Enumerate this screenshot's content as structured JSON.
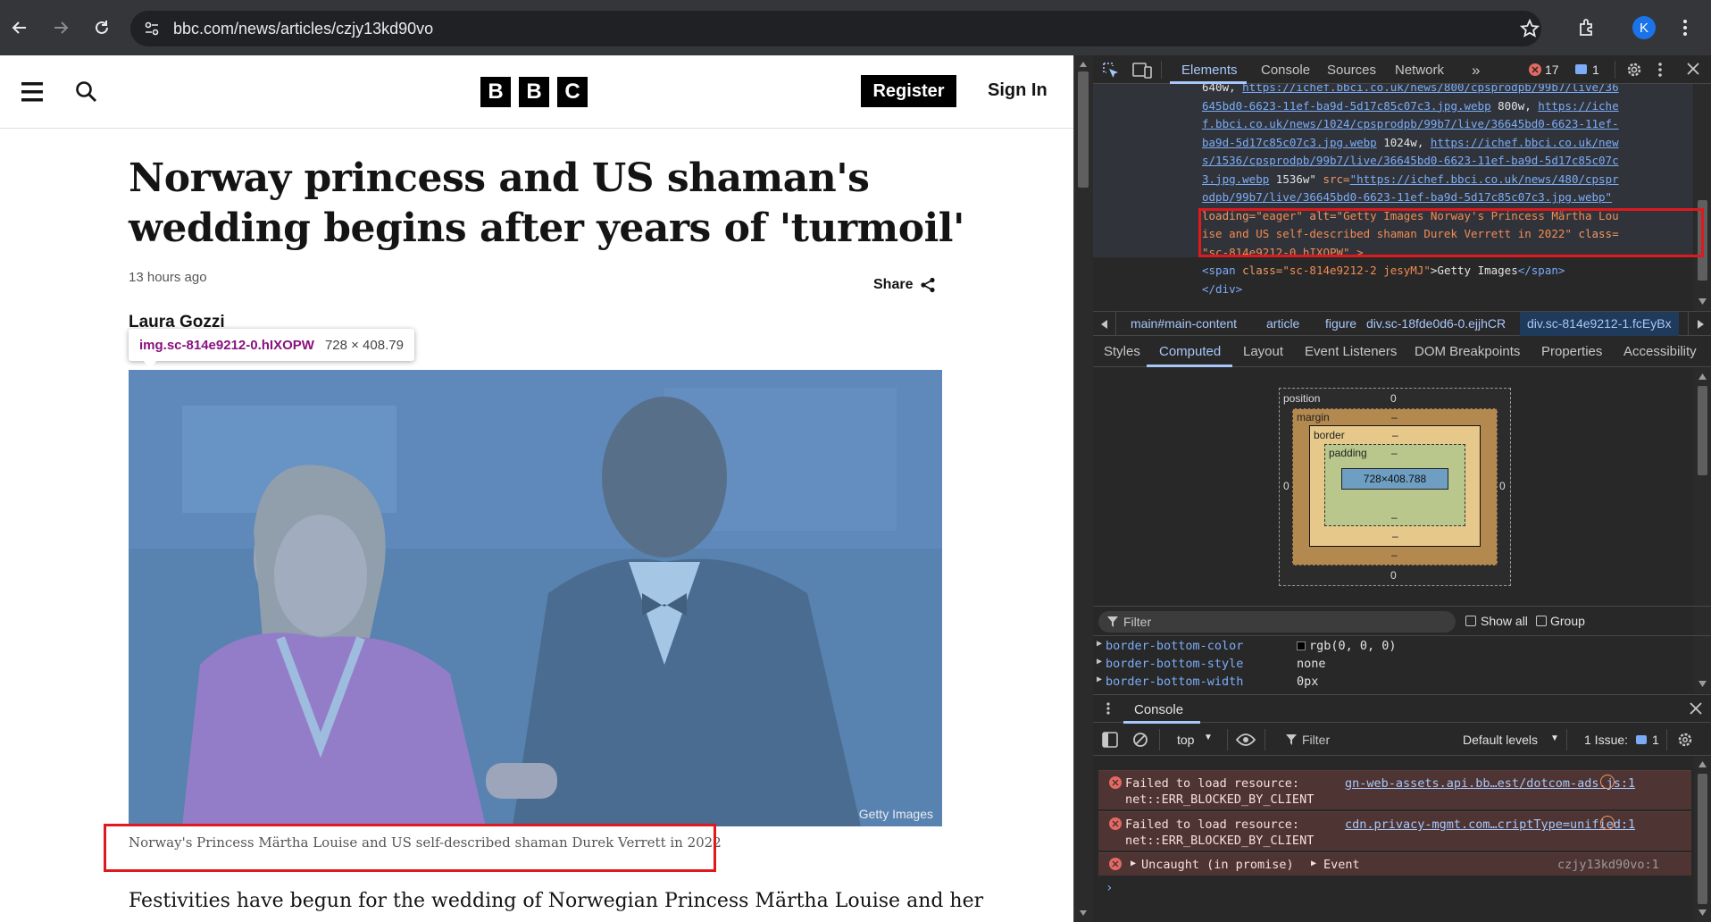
{
  "browser": {
    "url": "bbc.com/news/articles/czjy13kd90vo",
    "avatar_letter": "K"
  },
  "bbc": {
    "logo": [
      "B",
      "B",
      "C"
    ],
    "register_label": "Register",
    "signin_label": "Sign In"
  },
  "article": {
    "headline": "Norway princess and US shaman's wedding begins after years of 'turmoil'",
    "timestamp": "13 hours ago",
    "share_label": "Share",
    "author": "Laura Gozzi",
    "image_credit": "Getty Images",
    "caption": "Norway's Princess Märtha Louise and US self-described shaman Durek Verrett in 2022",
    "body_first_line": "Festivities have begun for the wedding of Norwegian Princess Märtha Louise and her"
  },
  "inspect_tooltip": {
    "selector": "img.sc-814e9212-0.hIXOPW",
    "size": "728 × 408.79"
  },
  "devtools": {
    "tabs": [
      "Elements",
      "Console",
      "Sources",
      "Network"
    ],
    "active_tab": "Elements",
    "error_count": "17",
    "message_count": "1",
    "source_lines": [
      {
        "parts": [
          {
            "t": "640w, ",
            "c": "text"
          },
          {
            "t": "https://ichef.bbci.co.uk/news/800/cpsprodpb/99b7/live/36",
            "c": "link"
          }
        ]
      },
      {
        "parts": [
          {
            "t": "645bd0-6623-11ef-ba9d-5d17c85c07c3.jpg.webp",
            "c": "link"
          },
          {
            "t": " 800w, ",
            "c": "text"
          },
          {
            "t": "https://iche",
            "c": "link"
          }
        ]
      },
      {
        "parts": [
          {
            "t": "f.bbci.co.uk/news/1024/cpsprodpb/99b7/live/36645bd0-6623-11ef-",
            "c": "link"
          }
        ]
      },
      {
        "parts": [
          {
            "t": "ba9d-5d17c85c07c3.jpg.webp",
            "c": "link"
          },
          {
            "t": " 1024w, ",
            "c": "text"
          },
          {
            "t": "https://ichef.bbci.co.uk/new",
            "c": "link"
          }
        ]
      },
      {
        "parts": [
          {
            "t": "s/1536/cpsprodpb/99b7/live/36645bd0-6623-11ef-ba9d-5d17c85c07c",
            "c": "link"
          }
        ]
      },
      {
        "parts": [
          {
            "t": "3.jpg.webp",
            "c": "link"
          },
          {
            "t": " 1536w\"",
            "c": "text"
          },
          {
            "t": " src=",
            "c": "attr"
          },
          {
            "t": "\"https://ichef.bbci.co.uk/news/480/cpspr",
            "c": "link"
          }
        ]
      },
      {
        "parts": [
          {
            "t": "odpb/99b7/live/36645bd0-6623-11ef-ba9d-5d17c85c07c3.jpg.webp\"",
            "c": "link"
          }
        ]
      },
      {
        "parts": [
          {
            "t": "loading=",
            "c": "attr"
          },
          {
            "t": "\"eager\"",
            "c": "val"
          },
          {
            "t": " alt=",
            "c": "attr"
          },
          {
            "t": "\"Getty Images Norway's Princess Märtha Lou",
            "c": "val"
          }
        ]
      },
      {
        "parts": [
          {
            "t": "ise and US self-described shaman Durek Verrett in 2022\"",
            "c": "val"
          },
          {
            "t": " class=",
            "c": "attr"
          }
        ]
      },
      {
        "parts": [
          {
            "t": "\"sc-814e9212-0 hIXOPW\" >",
            "c": "val"
          }
        ]
      },
      {
        "parts": [
          {
            "t": "<span ",
            "c": "tag"
          },
          {
            "t": "class=",
            "c": "attr"
          },
          {
            "t": "\"sc-814e9212-2 jesyMJ\"",
            "c": "val"
          },
          {
            "t": ">Getty Images",
            "c": "text"
          },
          {
            "t": "</span>",
            "c": "tag"
          }
        ]
      },
      {
        "parts": [
          {
            "t": "</div>",
            "c": "tag"
          }
        ]
      }
    ],
    "breadcrumbs": [
      "main#main-content",
      "article",
      "figure",
      "div.sc-18fde0d6-0.ejjhCR",
      "div.sc-814e9212-1.fcEyBx"
    ],
    "subtabs": [
      "Styles",
      "Computed",
      "Layout",
      "Event Listeners",
      "DOM Breakpoints",
      "Properties",
      "Accessibility"
    ],
    "active_subtab": "Computed",
    "box_model": {
      "position_label": "position",
      "position_value": "0",
      "margin_label": "margin",
      "border_label": "border",
      "padding_label": "padding",
      "dash": "–",
      "zero": "0",
      "content_size": "728×408.788"
    },
    "filter_placeholder": "Filter",
    "show_all_label": "Show all",
    "group_label": "Group",
    "computed_props": [
      {
        "name": "border-bottom-color",
        "value": "rgb(0, 0, 0)"
      },
      {
        "name": "border-bottom-style",
        "value": "none"
      },
      {
        "name": "border-bottom-width",
        "value": "0px"
      }
    ],
    "console": {
      "title": "Console",
      "context": "top",
      "filter_placeholder": "Filter",
      "levels": "Default levels",
      "issues_label": "1 Issue:",
      "issues_count": "1",
      "messages": [
        {
          "text1": "Failed to load resource:",
          "text2": "net::ERR_BLOCKED_BY_CLIENT",
          "source": "gn-web-assets.api.bb…est/dotcom-ads.js:1"
        },
        {
          "text1": "Failed to load resource:",
          "text2": "net::ERR_BLOCKED_BY_CLIENT",
          "source": "cdn.privacy-mgmt.com…criptType=unified:1"
        },
        {
          "text1": "Uncaught (in promise)",
          "text2": "Event",
          "source": "czjy13kd90vo:1"
        }
      ]
    }
  },
  "colors": {
    "highlight_red": "#e0191f",
    "overlay_blue": "#6fa8dc",
    "dress_magenta": "#c04bb0"
  }
}
